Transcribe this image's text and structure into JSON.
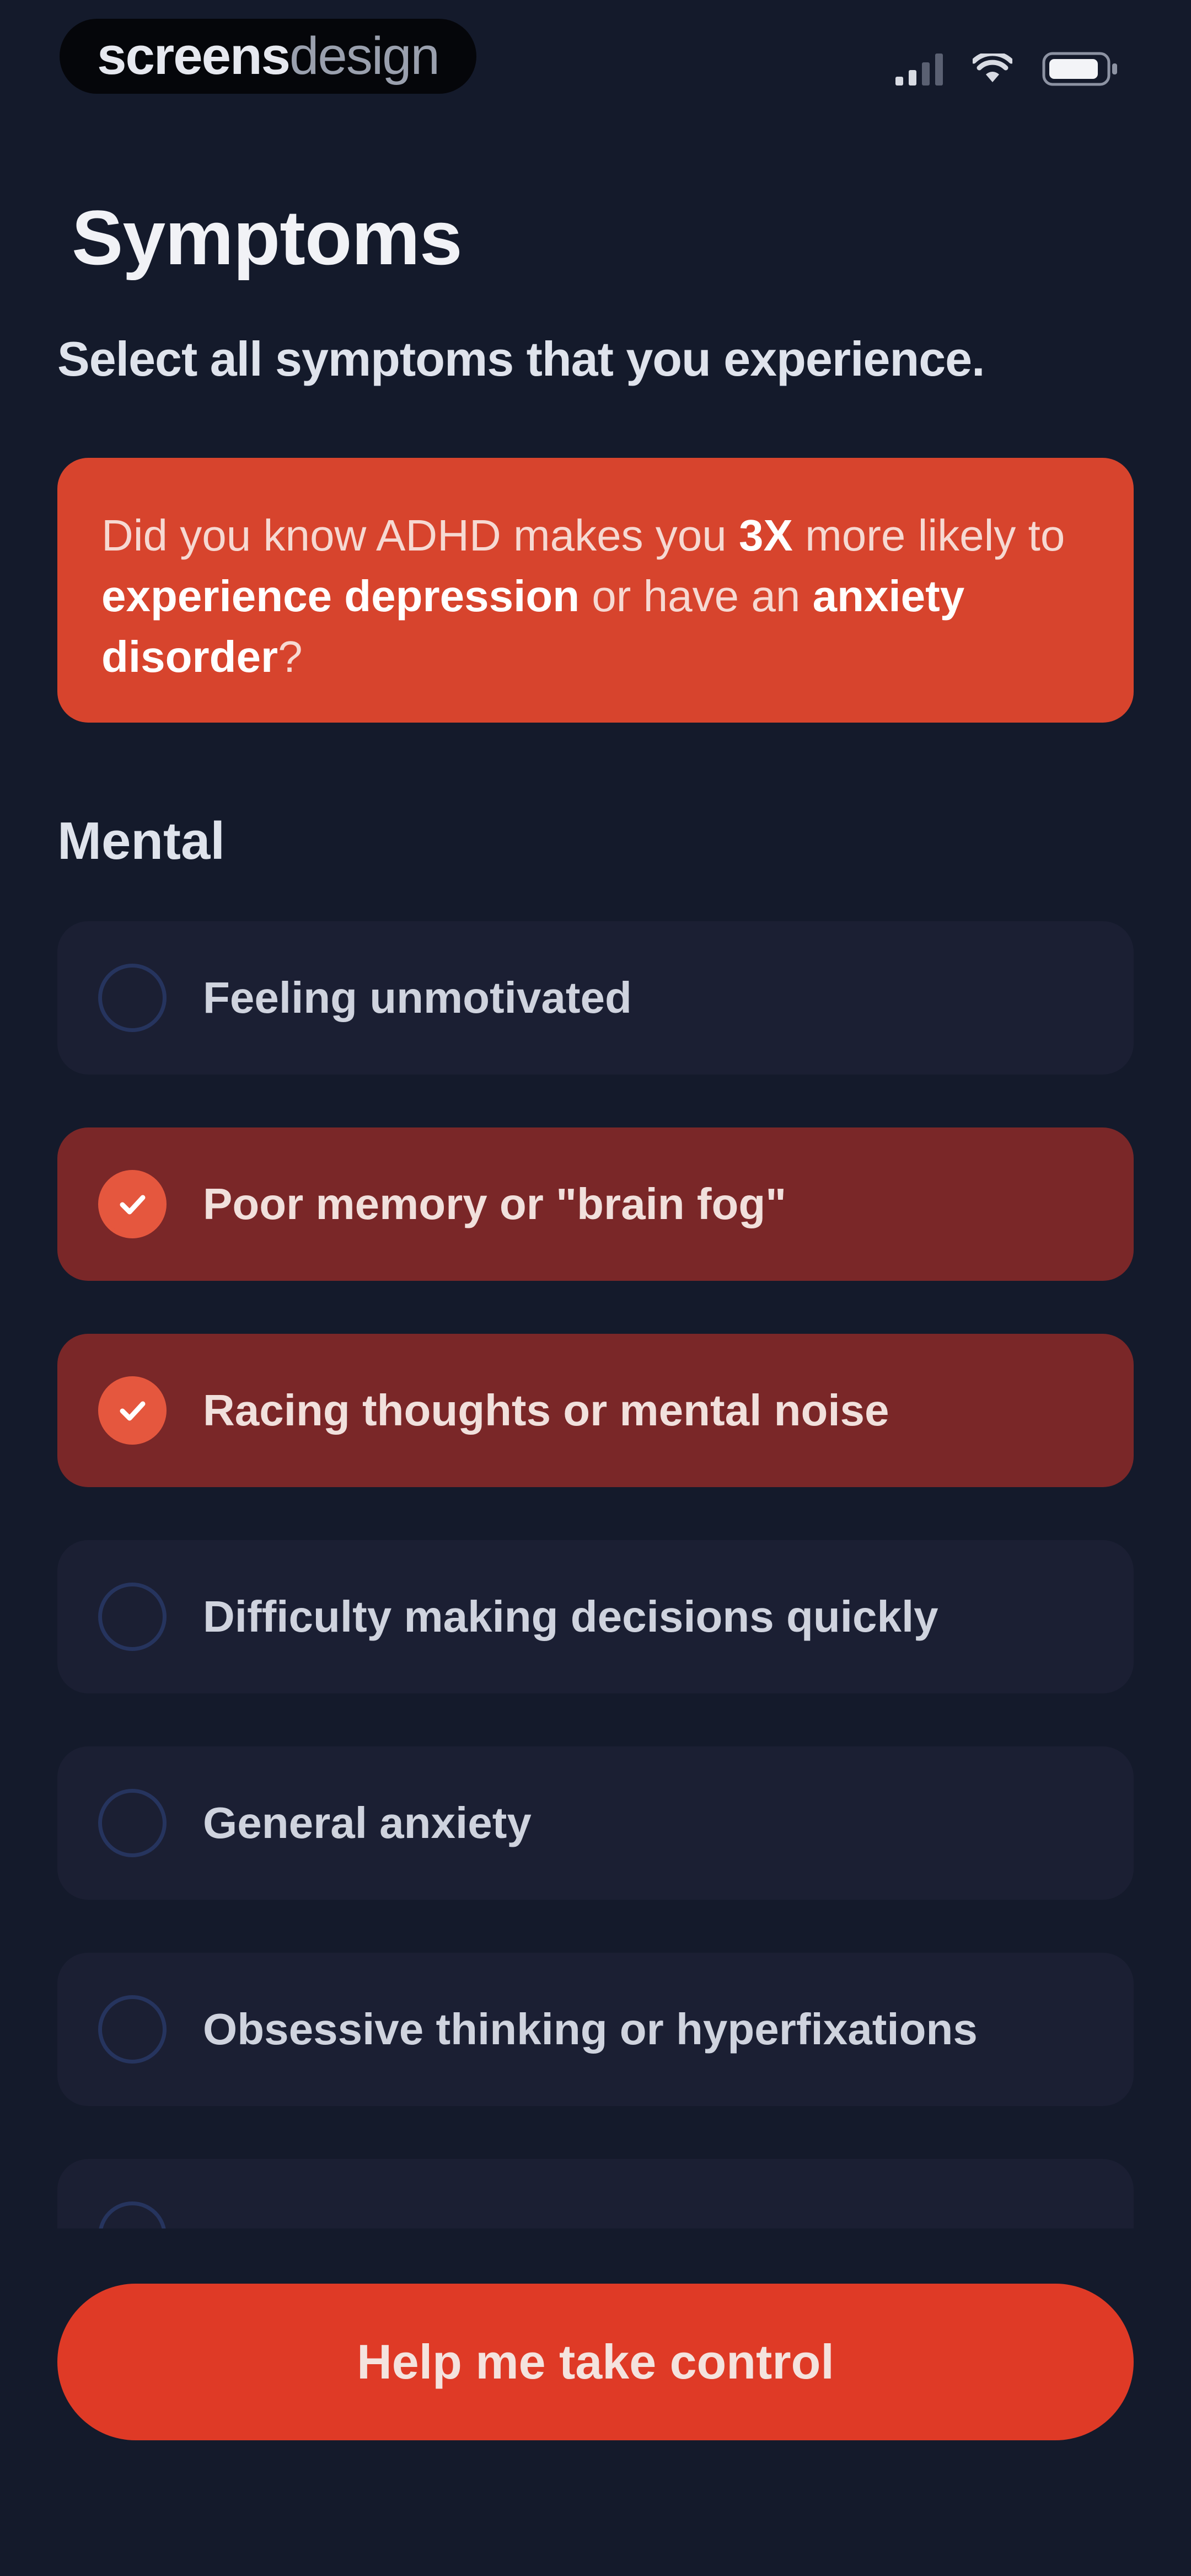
{
  "status_bar": {
    "brand_bold": "screens",
    "brand_light": "design",
    "icons": [
      "signal-icon",
      "wifi-icon",
      "battery-icon"
    ]
  },
  "header": {
    "title": "Symptoms",
    "subtitle": "Select all symptoms that you experience."
  },
  "info_card": {
    "segments": [
      {
        "text": "Did you know ADHD makes you ",
        "bold": false
      },
      {
        "text": "3X",
        "bold": true
      },
      {
        "text": " more likely to ",
        "bold": false
      },
      {
        "text": "experience depression",
        "bold": true
      },
      {
        "text": " or have an ",
        "bold": false
      },
      {
        "text": "anxiety disorder",
        "bold": true
      },
      {
        "text": "?",
        "bold": false
      }
    ]
  },
  "section": {
    "label": "Mental"
  },
  "symptoms": [
    {
      "label": "Feeling unmotivated",
      "selected": false
    },
    {
      "label": "Poor memory or \"brain fog\"",
      "selected": true
    },
    {
      "label": "Racing thoughts or mental noise",
      "selected": true
    },
    {
      "label": "Difficulty making decisions quickly",
      "selected": false
    },
    {
      "label": "General anxiety",
      "selected": false
    },
    {
      "label": "Obsessive thinking or hyperfixations",
      "selected": false
    },
    {
      "label": "",
      "selected": false
    }
  ],
  "cta": {
    "label": "Help me take control"
  },
  "colors": {
    "background": "#141a2b",
    "accent": "#df3a26",
    "card": "#1b1f33",
    "selected_card": "#7a2728"
  }
}
